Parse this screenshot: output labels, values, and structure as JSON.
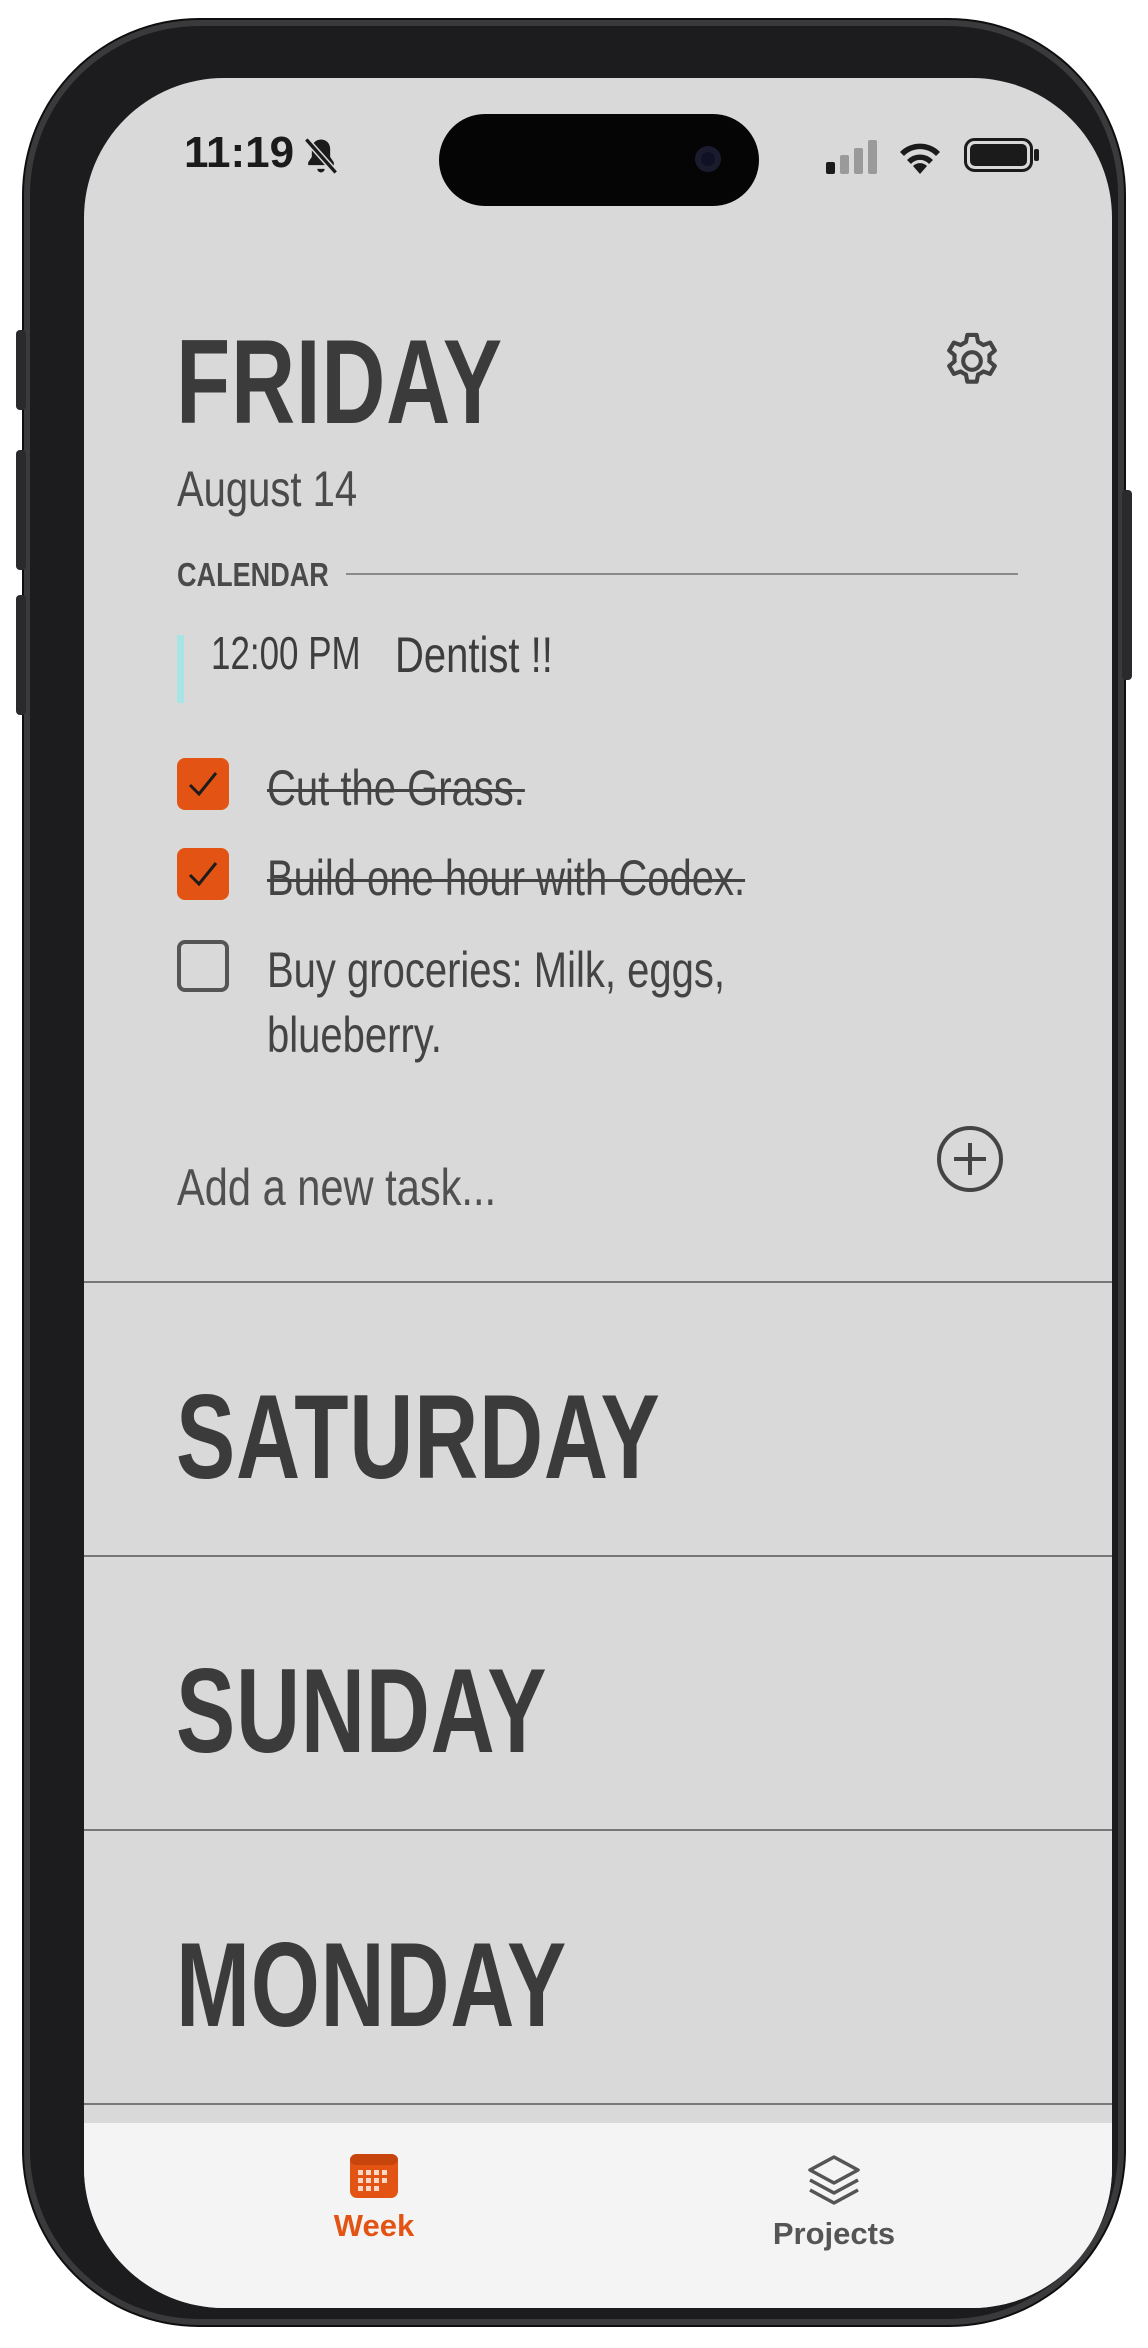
{
  "status_bar": {
    "time": "11:19"
  },
  "colors": {
    "accent": "#e35414",
    "event_bar": "#a8e3e6",
    "screen_bg": "#d9d9d9"
  },
  "friday": {
    "title": "FRIDAY",
    "date": "August 14",
    "calendar_label": "CALENDAR",
    "event": {
      "time": "12:00 PM",
      "title": "Dentist !!"
    },
    "tasks": [
      {
        "text": "Cut the Grass.",
        "done": true
      },
      {
        "text": "Build one hour with Codex.",
        "done": true
      },
      {
        "text": "Buy groceries: Milk, eggs, blueberry.",
        "done": false
      }
    ],
    "add_placeholder": "Add a new task..."
  },
  "days": [
    "SATURDAY",
    "SUNDAY",
    "MONDAY"
  ],
  "tabs": [
    {
      "label": "Week",
      "icon": "calendar-icon",
      "active": true
    },
    {
      "label": "Projects",
      "icon": "layers-icon",
      "active": false
    }
  ]
}
